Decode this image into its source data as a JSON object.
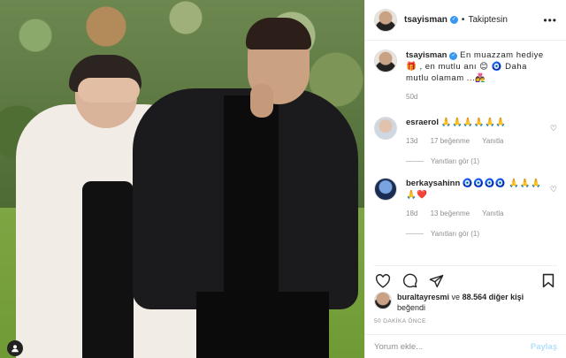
{
  "post": {
    "author": "tsayisman",
    "follow_status": "Takiptesin",
    "caption_user": "tsayisman",
    "caption_text": "En muazzam hediye 🎁 , en mutlu anı 😊 🧿 Daha mutlu olamam ...👩‍❤️‍👨",
    "caption_age": "50d"
  },
  "comments": [
    {
      "user": "esraerol",
      "text": "🙏🙏🙏🙏🙏🙏",
      "age": "13d",
      "likes": "17 beğenme",
      "reply_label": "Yanıtla",
      "view_replies": "Yanıtları gör (1)"
    },
    {
      "user": "berkaysahinn",
      "text": "🧿🧿🧿🧿 🙏🙏🙏🙏❤️",
      "age": "18d",
      "likes": "13 beğenme",
      "reply_label": "Yanıtla",
      "view_replies": "Yanıtları gör (1)"
    }
  ],
  "likes_summary": {
    "user": "buraltayresmi",
    "connector": "ve",
    "others": "88.564 diğer kişi",
    "suffix": "beğendi"
  },
  "time_ago": "50 DAKİKA ÖNCE",
  "comment_input": {
    "placeholder": "Yorum ekle...",
    "value": ""
  },
  "post_button": "Paylaş",
  "icons": {
    "like": "heart-icon",
    "comment": "comment-icon",
    "share": "send-icon",
    "save": "bookmark-icon",
    "options": "more-icon",
    "tagged": "user-tag-icon"
  },
  "colors": {
    "verified": "#3897f0",
    "muted_text": "#8e8e8e",
    "post_button_disabled": "#b2dffc"
  }
}
